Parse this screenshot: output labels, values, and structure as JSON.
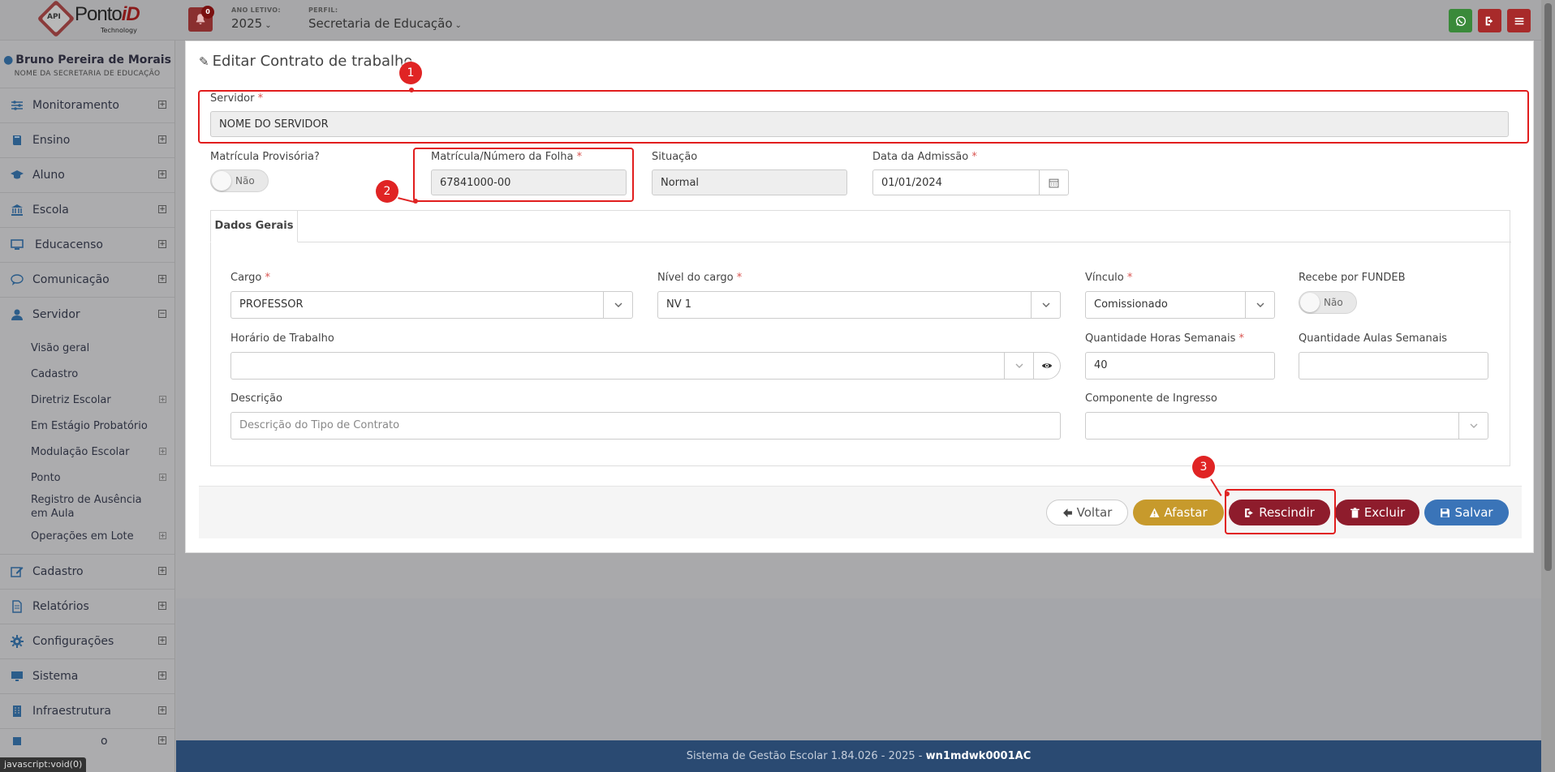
{
  "topbar": {
    "logo": {
      "api": "API",
      "brand_a": "Ponto",
      "brand_b": "iD",
      "tech": "Technology"
    },
    "notifications_count": "0",
    "ano_letivo_label": "ANO LETIVO:",
    "ano_letivo_value": "2025",
    "perfil_label": "PERFIL:",
    "perfil_value": "Secretaria de Educação",
    "icons": [
      {
        "name": "whatsapp-icon",
        "color": "#3a8a3a"
      },
      {
        "name": "logout-icon",
        "color": "#a82a2a"
      },
      {
        "name": "menu-icon",
        "color": "#a82a2a"
      }
    ]
  },
  "sidebar": {
    "user_name": "Bruno Pereira de Morais",
    "user_sub": "NOME DA SECRETARIA DE EDUCAÇÃO",
    "items_top": [
      {
        "label": "Monitoramento",
        "icon": "sliders-icon"
      },
      {
        "label": "Ensino",
        "icon": "book-icon"
      },
      {
        "label": "Aluno",
        "icon": "graduation-cap-icon"
      },
      {
        "label": "Escola",
        "icon": "bank-icon"
      },
      {
        "label": "Educacenso",
        "icon": "monitor-icon"
      },
      {
        "label": "Comunicação",
        "icon": "chat-icon"
      },
      {
        "label": "Servidor",
        "icon": "user-icon"
      }
    ],
    "servidor_sub": [
      {
        "label": "Visão geral",
        "expandable": false
      },
      {
        "label": "Cadastro",
        "expandable": false
      },
      {
        "label": "Diretriz Escolar",
        "expandable": true
      },
      {
        "label": "Em Estágio Probatório",
        "expandable": false
      },
      {
        "label": "Modulação Escolar",
        "expandable": true
      },
      {
        "label": "Ponto",
        "expandable": true
      },
      {
        "label": "Registro de Ausência em Aula",
        "expandable": false
      },
      {
        "label": "Operações em Lote",
        "expandable": true
      }
    ],
    "items_bottom": [
      {
        "label": "Cadastro",
        "icon": "edit-icon"
      },
      {
        "label": "Relatórios",
        "icon": "file-icon"
      },
      {
        "label": "Configurações",
        "icon": "gear-icon"
      },
      {
        "label": "Sistema",
        "icon": "desktop-icon"
      },
      {
        "label": "Infraestrutura",
        "icon": "building-icon"
      }
    ]
  },
  "form": {
    "title": "Editar Contrato de trabalho",
    "servidor_label": "Servidor",
    "servidor_value": "NOME DO SERVIDOR",
    "matricula_provisoria_label": "Matrícula Provisória?",
    "matricula_provisoria_value": "Não",
    "matricula_label": "Matrícula/Número da Folha",
    "matricula_value": "67841000-00",
    "situacao_label": "Situação",
    "situacao_value": "Normal",
    "data_admissao_label": "Data da Admissão",
    "data_admissao_value": "01/01/2024",
    "tab_label": "Dados Gerais",
    "cargo_label": "Cargo",
    "cargo_value": "PROFESSOR",
    "nivel_label": "Nível do cargo",
    "nivel_value": "NV 1",
    "vinculo_label": "Vínculo",
    "vinculo_value": "Comissionado",
    "fundeb_label": "Recebe por FUNDEB",
    "fundeb_value": "Não",
    "horario_label": "Horário de Trabalho",
    "horario_value": "",
    "horas_label": "Quantidade Horas Semanais",
    "horas_value": "40",
    "aulas_label": "Quantidade Aulas Semanais",
    "aulas_value": "",
    "descricao_label": "Descrição",
    "descricao_placeholder": "Descrição do Tipo de Contrato",
    "componente_label": "Componente de Ingresso",
    "componente_value": ""
  },
  "buttons": {
    "voltar": "Voltar",
    "afastar": "Afastar",
    "rescindir": "Rescindir",
    "excluir": "Excluir",
    "salvar": "Salvar"
  },
  "colors": {
    "afastar": "#c79a2c",
    "rescindir": "#8e1c2c",
    "excluir": "#8e1c2c",
    "salvar": "#3a74b8",
    "annotation": "#e02424"
  },
  "annotations": [
    "1",
    "2",
    "3"
  ],
  "footer": {
    "text": "Sistema de Gestão Escolar 1.84.026 - 2025 - ",
    "bold": "wn1mdwk0001AC"
  },
  "status_tip": "javascript:void(0)",
  "partial_menu_text": "o"
}
